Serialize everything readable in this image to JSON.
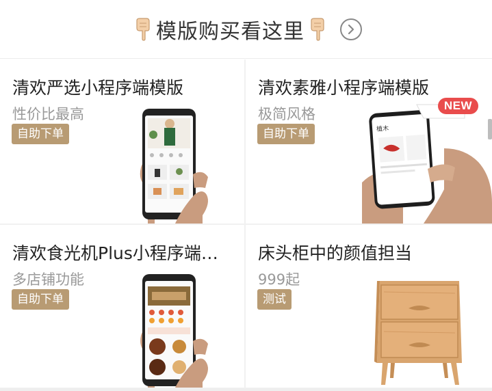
{
  "header": {
    "title": "模版购买看这里",
    "left_icon": "pointing-down-hand-icon",
    "right_icon": "pointing-down-hand-icon",
    "action_icon": "chevron-right-circle-icon"
  },
  "products": [
    {
      "name": "清欢严选小程序端模版",
      "desc": "性价比最高",
      "tag": "自助下单",
      "image": "phone-in-hand-fashion"
    },
    {
      "name": "清欢素雅小程序端模版",
      "desc": "极简风格",
      "tag": "自助下单",
      "badge": "NEW",
      "image": "phone-in-hand-minimal"
    },
    {
      "name": "清欢食光机Plus小程序端…",
      "desc": "多店铺功能",
      "tag": "自助下单",
      "image": "phone-in-hand-food"
    },
    {
      "name": "床头柜中的颜值担当",
      "desc": "999起",
      "tag": "测试",
      "image": "wooden-nightstand"
    }
  ],
  "colors": {
    "tag_bg": "#b89b73",
    "badge_bg": "#e94c4c",
    "muted_text": "#999999"
  }
}
